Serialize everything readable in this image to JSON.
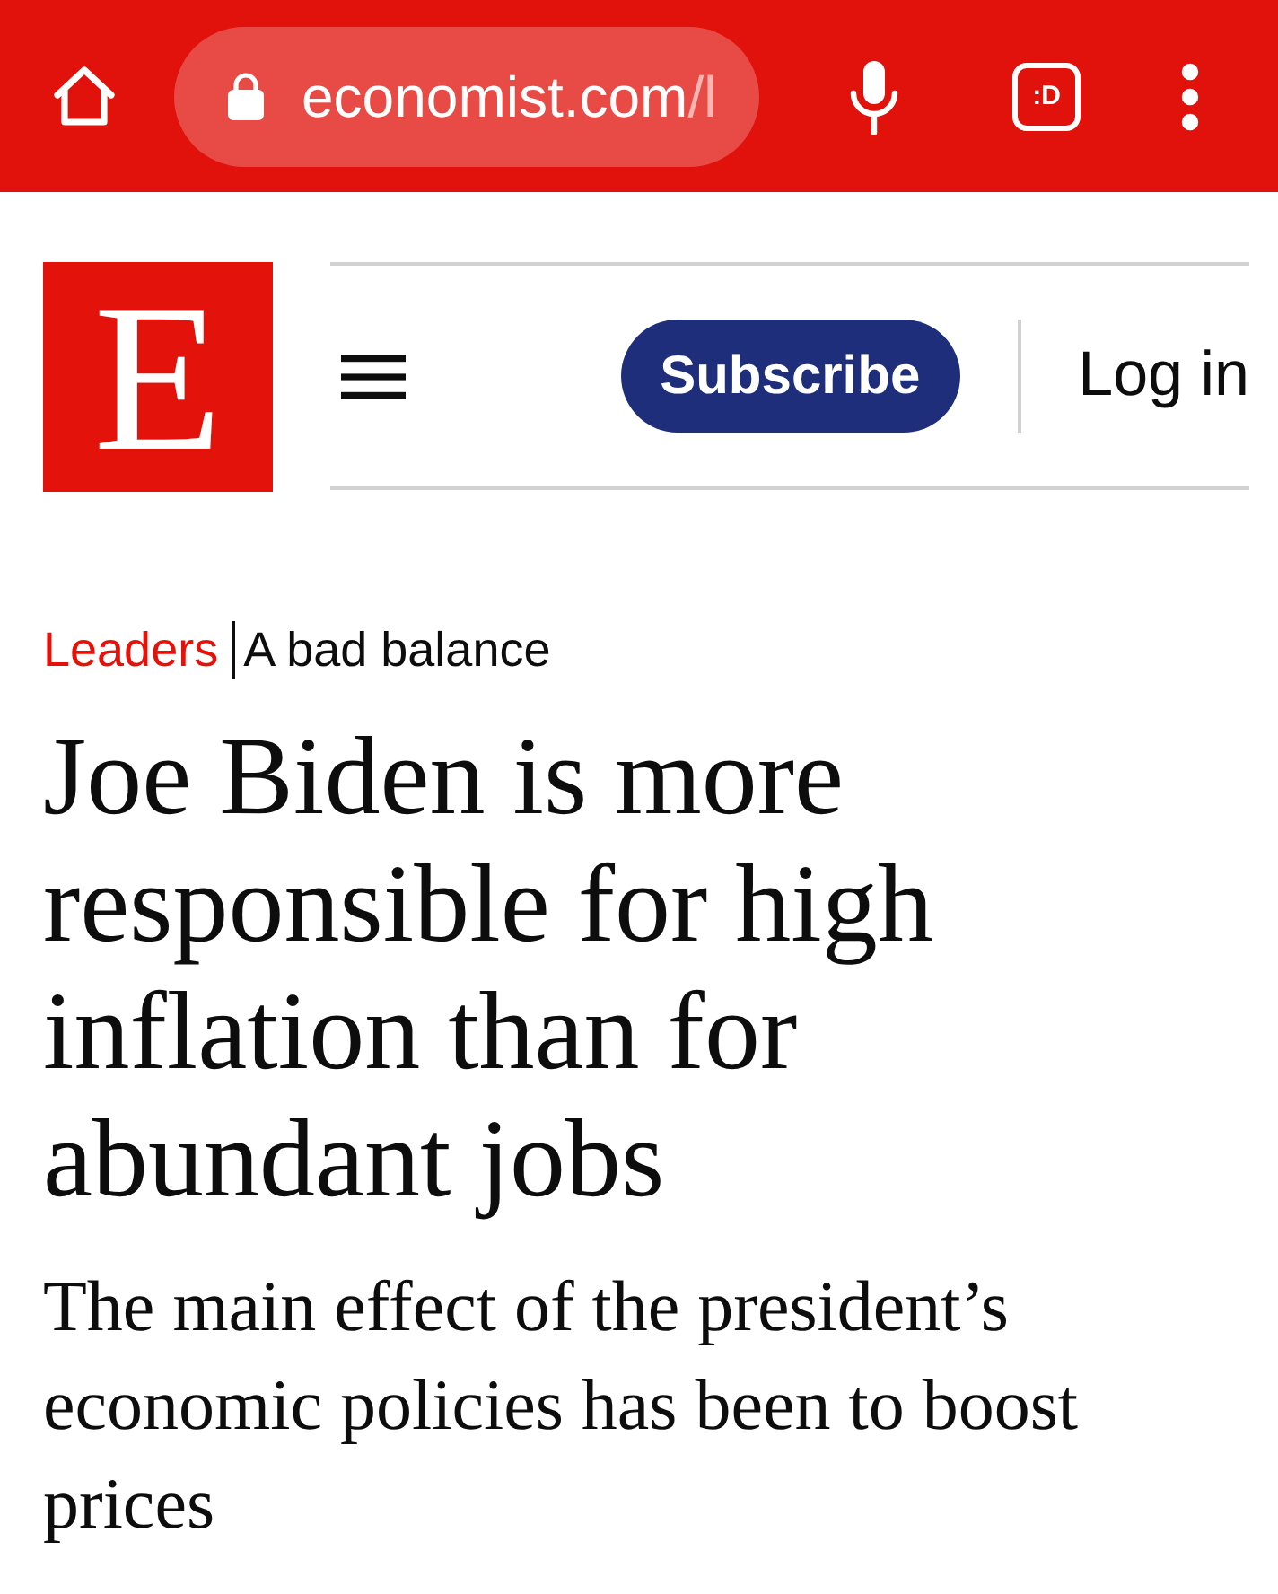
{
  "browser_bar": {
    "url_host": "economist.com",
    "url_path": "/l",
    "tab_count": ":D"
  },
  "masthead": {
    "logo_letter": "E",
    "subscribe_label": "Subscribe",
    "login_label": "Log in"
  },
  "article": {
    "section": "Leaders",
    "rubric": "A bad balance",
    "headline": "Joe Biden is more responsible for high inflation than for abundant jobs",
    "standfirst": "The main effect of the president’s economic policies has been to boost prices"
  }
}
